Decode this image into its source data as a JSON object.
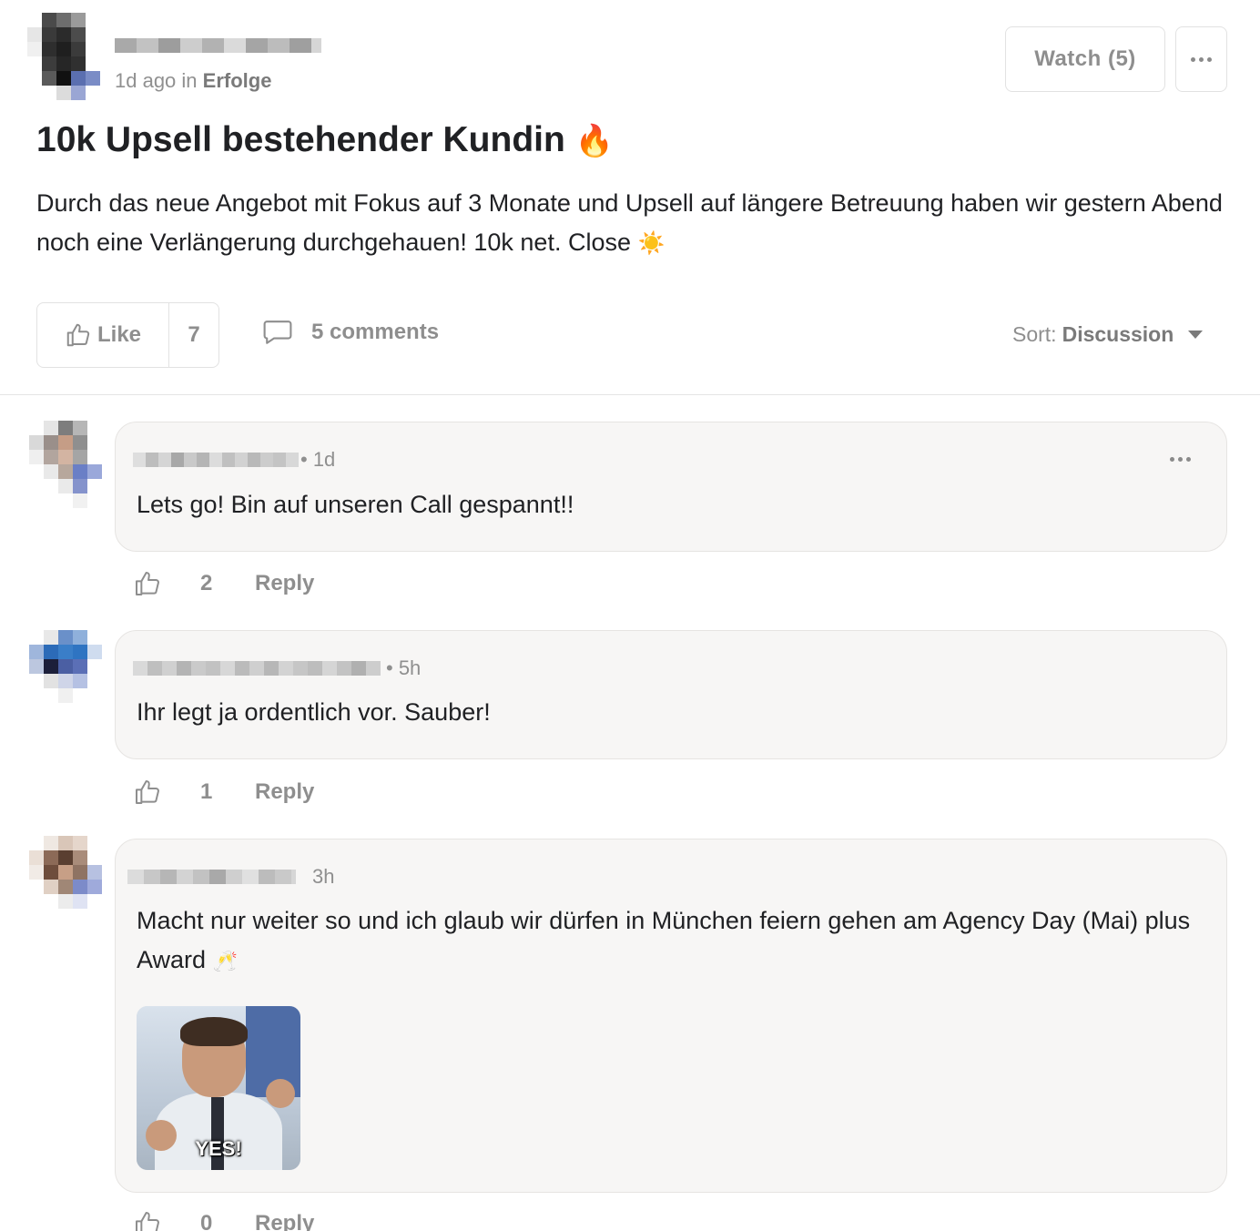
{
  "post": {
    "meta_time": "1d ago in",
    "category": "Erfolge",
    "watch_label": "Watch (5)",
    "title": "10k Upsell bestehender Kundin",
    "title_emoji": "🔥",
    "body": "Durch das neue Angebot mit Fokus auf 3 Monate und Upsell auf längere Betreuung haben wir gestern Abend noch eine Verlängerung durchgehauen! 10k net. Close",
    "body_emoji": "☀️",
    "like_label": "Like",
    "like_count": "7",
    "comments_label": "5 comments",
    "sort_prefix": "Sort:",
    "sort_value": "Discussion"
  },
  "comments": [
    {
      "time": "• 1d",
      "text": "Lets go! Bin auf unseren Call gespannt!!",
      "likes": "2",
      "reply_label": "Reply"
    },
    {
      "time": "• 5h",
      "text": "Ihr legt ja ordentlich vor. Sauber!",
      "likes": "1",
      "reply_label": "Reply"
    },
    {
      "time": "3h",
      "text": "Macht nur weiter so und ich glaub wir dürfen in München feiern gehen am Agency Day (Mai) plus Award",
      "text_emoji": "🥂",
      "gif_caption": "YES!",
      "likes": "0",
      "reply_label": "Reply"
    }
  ],
  "colors": {
    "text": "#202124",
    "muted": "#8e8e8e",
    "bubble_bg": "#f7f6f5",
    "border": "#e2e2e2"
  }
}
